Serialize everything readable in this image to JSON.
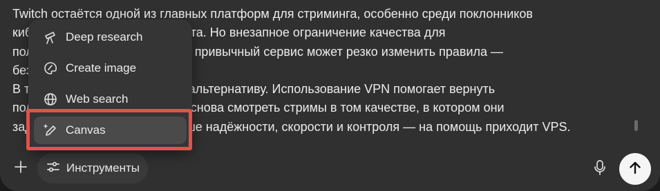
{
  "message_text": [
    "Twitch остаётся одной из главных платформ для стриминга, особенно среди поклонников",
    "киберспорта и игрового контента. Но внезапное ограничение качества для",
    "пользователей показало: даже привычный сервис может резко изменить правила —",
    "без каких-либо объяснений.",
    "В такой ситуации стоит иметь альтернативу. Использование VPN помогает вернуть",
    "полный доступ к платформе и снова смотреть стримы в том качестве, в котором они",
    "задуманы. А если нужно больше надёжности, скорости и контроля — на помощь приходит VPS."
  ],
  "composer": {
    "tools_label": "Инструменты",
    "plus_icon": "plus-icon",
    "tools_icon": "sliders-icon",
    "mic_icon": "microphone-icon",
    "send_icon": "arrow-up-icon"
  },
  "tools_menu": {
    "items": [
      {
        "label": "Deep research",
        "icon": "telescope-icon"
      },
      {
        "label": "Create image",
        "icon": "image-palette-icon"
      },
      {
        "label": "Web search",
        "icon": "globe-icon"
      },
      {
        "label": "Canvas",
        "icon": "pencil-sparkle-icon",
        "highlighted": true
      }
    ]
  },
  "colors": {
    "composer_bg": "#303030",
    "menu_bg": "#353535",
    "highlight": "#e0524b",
    "send_button": "#f5f5f5"
  }
}
